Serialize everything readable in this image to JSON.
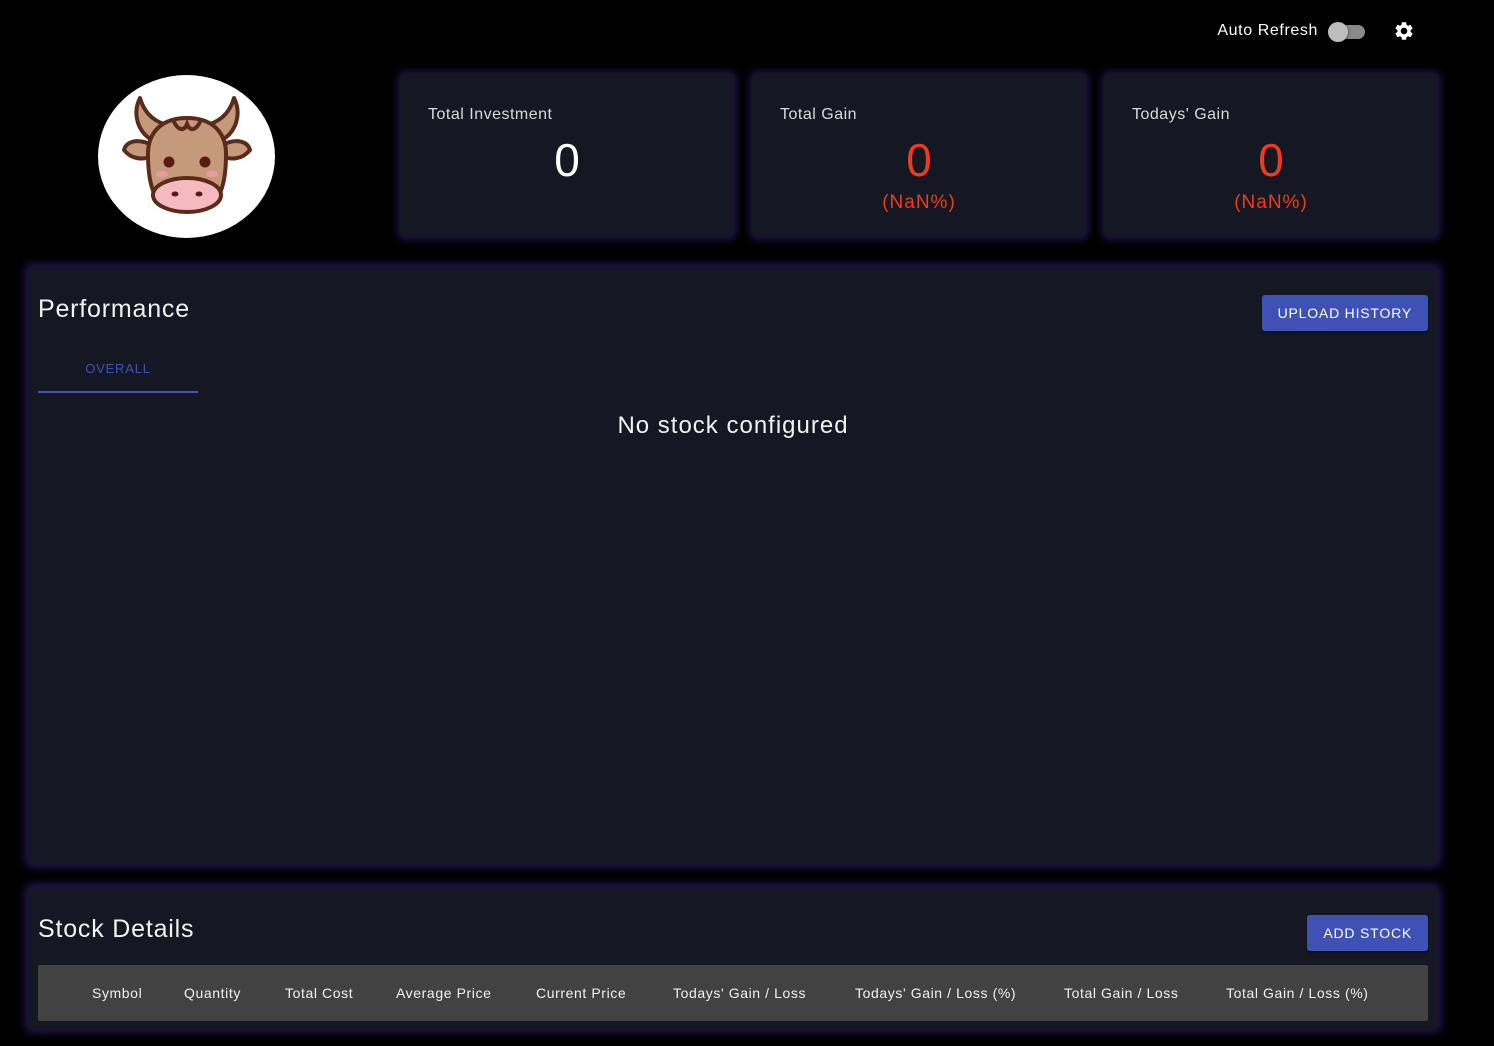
{
  "topbar": {
    "auto_refresh_label": "Auto Refresh",
    "auto_refresh_on": false,
    "settings_icon": "gear-icon"
  },
  "avatar": {
    "icon": "bull-face-logo"
  },
  "summary": {
    "total_investment": {
      "label": "Total Investment",
      "value": "0"
    },
    "total_gain": {
      "label": "Total Gain",
      "value": "0",
      "percent": "(NaN%)"
    },
    "todays_gain": {
      "label": "Todays' Gain",
      "value": "0",
      "percent": "(NaN%)"
    }
  },
  "performance": {
    "title": "Performance",
    "upload_button": "UPLOAD HISTORY",
    "tabs": [
      {
        "label": "OVERALL",
        "active": true
      }
    ],
    "empty_message": "No stock configured"
  },
  "stock_details": {
    "title": "Stock Details",
    "add_button": "ADD STOCK",
    "columns": [
      "Symbol",
      "Quantity",
      "Total Cost",
      "Average Price",
      "Current Price",
      "Todays' Gain / Loss",
      "Todays' Gain / Loss (%)",
      "Total Gain / Loss",
      "Total Gain / Loss (%)"
    ],
    "rows": []
  },
  "colors": {
    "background": "#000000",
    "card": "#151822",
    "accent": "#3f51b5",
    "negative": "#f13a1b",
    "table_header": "#424242"
  }
}
